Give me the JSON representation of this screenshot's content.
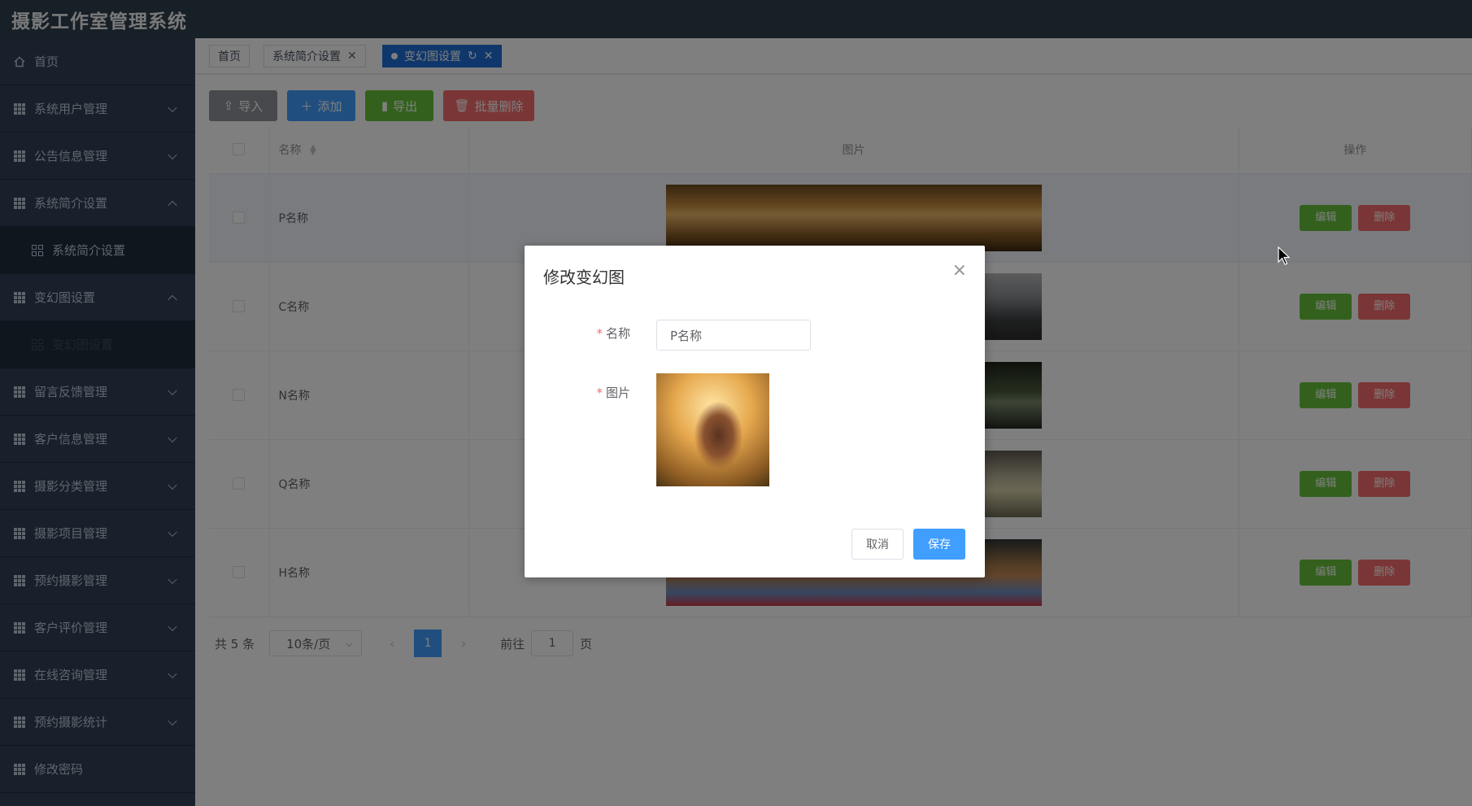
{
  "app": {
    "title": "摄影工作室管理系统"
  },
  "sidebar": {
    "items": [
      {
        "label": "首页",
        "icon": "home-icon"
      },
      {
        "label": "系统用户管理",
        "icon": "grid-icon",
        "expanded": false
      },
      {
        "label": "公告信息管理",
        "icon": "grid-icon",
        "expanded": false
      },
      {
        "label": "系统简介设置",
        "icon": "grid-icon",
        "expanded": true
      },
      {
        "label": "系统简介设置",
        "icon": "grid4-icon",
        "submenu": true
      },
      {
        "label": "变幻图设置",
        "icon": "grid-icon",
        "expanded": true
      },
      {
        "label": "变幻图设置",
        "icon": "grid4-icon",
        "submenu": true,
        "active": true
      },
      {
        "label": "留言反馈管理",
        "icon": "grid-icon",
        "expanded": false
      },
      {
        "label": "客户信息管理",
        "icon": "grid-icon",
        "expanded": false
      },
      {
        "label": "摄影分类管理",
        "icon": "grid-icon",
        "expanded": false
      },
      {
        "label": "摄影项目管理",
        "icon": "grid-icon",
        "expanded": false
      },
      {
        "label": "预约摄影管理",
        "icon": "grid-icon",
        "expanded": false
      },
      {
        "label": "客户评价管理",
        "icon": "grid-icon",
        "expanded": false
      },
      {
        "label": "在线咨询管理",
        "icon": "grid-icon",
        "expanded": false
      },
      {
        "label": "预约摄影统计",
        "icon": "grid-icon",
        "expanded": false
      },
      {
        "label": "修改密码",
        "icon": "grid-icon"
      }
    ]
  },
  "tabs": [
    {
      "label": "首页"
    },
    {
      "label": "系统简介设置"
    },
    {
      "label": "变幻图设置",
      "active": true
    }
  ],
  "toolbar": {
    "import_label": "导入",
    "add_label": "添加",
    "export_label": "导出",
    "batch_delete_label": "批量删除"
  },
  "table": {
    "headers": {
      "name": "名称",
      "image": "图片",
      "actions": "操作"
    },
    "rows": [
      {
        "name": "P名称"
      },
      {
        "name": "C名称"
      },
      {
        "name": "N名称"
      },
      {
        "name": "Q名称"
      },
      {
        "name": "H名称"
      }
    ],
    "edit_label": "编辑",
    "delete_label": "删除"
  },
  "pagination": {
    "total": "共 5 条",
    "page_size": "10条/页",
    "current_page": "1",
    "goto_prefix": "前往",
    "goto_value": "1",
    "goto_suffix": "页"
  },
  "dialog": {
    "title": "修改变幻图",
    "name_label": "名称",
    "name_value": "P名称",
    "image_label": "图片",
    "cancel_label": "取消",
    "save_label": "保存"
  },
  "colors": {
    "primary": "#409eff",
    "success": "#67c23a",
    "danger": "#f56c6c",
    "sidebar_bg": "#304156",
    "header_bg": "#2f3e4e"
  }
}
